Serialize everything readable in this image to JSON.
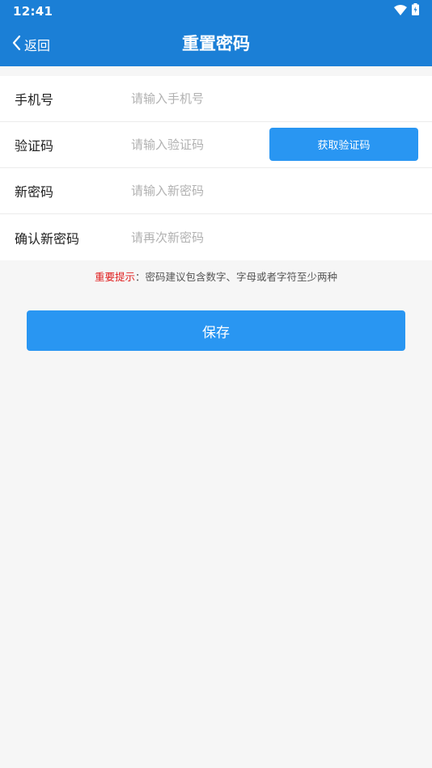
{
  "status_bar": {
    "time": "12:41",
    "icons": [
      "wifi-icon",
      "battery-charging-icon"
    ]
  },
  "nav": {
    "back_label": "返回",
    "title": "重置密码"
  },
  "form": {
    "phone": {
      "label": "手机号",
      "placeholder": "请输入手机号",
      "value": ""
    },
    "code": {
      "label": "验证码",
      "placeholder": "请输入验证码",
      "value": "",
      "button_label": "获取验证码"
    },
    "new_password": {
      "label": "新密码",
      "placeholder": "请输入新密码",
      "value": ""
    },
    "confirm_password": {
      "label": "确认新密码",
      "placeholder": "请再次新密码",
      "value": ""
    }
  },
  "hint": {
    "key": "重要提示",
    "separator": "：",
    "text": "密码建议包含数字、字母或者字符至少两种"
  },
  "save_label": "保存",
  "colors": {
    "header": "#1b7fd6",
    "button": "#2996f2",
    "hint_key": "#e02020",
    "background": "#f6f6f6"
  }
}
